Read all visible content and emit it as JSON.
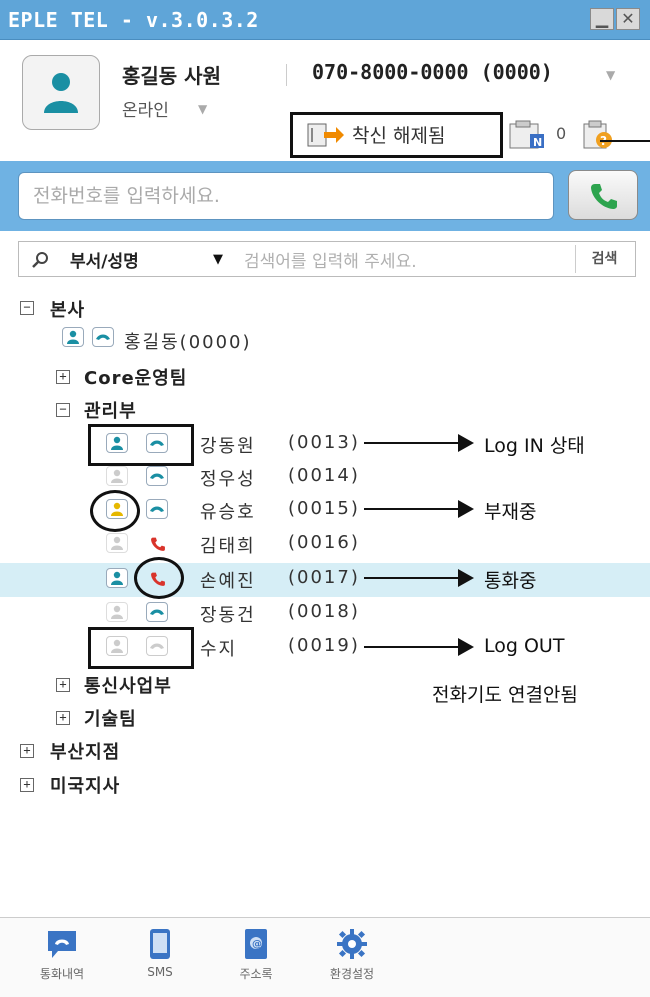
{
  "window": {
    "title": "EPLE TEL - v.3.0.3.2"
  },
  "profile": {
    "name": "홍길동 사원",
    "phone": "070-8000-0000 (0000)",
    "status": "온라인"
  },
  "forwarding": {
    "label": "착신 해제됨",
    "note_count": "0"
  },
  "dial": {
    "placeholder": "전화번호를 입력하세요."
  },
  "search": {
    "type": "부서/성명",
    "placeholder": "검색어를 입력해 주세요.",
    "button": "검색"
  },
  "tree": {
    "root": "본사",
    "head": "홍길동(0000)",
    "teams": [
      "Core운영팀",
      "관리부",
      "통신사업부",
      "기술팀"
    ],
    "members": [
      {
        "name": "강동원",
        "ext": "(0013)"
      },
      {
        "name": "정우성",
        "ext": "(0014)"
      },
      {
        "name": "유승호",
        "ext": "(0015)"
      },
      {
        "name": "김태희",
        "ext": "(0016)"
      },
      {
        "name": "손예진",
        "ext": "(0017)"
      },
      {
        "name": "장동건",
        "ext": "(0018)"
      },
      {
        "name": "수지",
        "ext": "(0019)"
      }
    ],
    "branches": [
      "부산지점",
      "미국지사"
    ]
  },
  "annotations": {
    "login": "Log IN 상태",
    "away": "부재중",
    "calling": "통화중",
    "logout": "Log OUT",
    "logout_note": "전화기도 연결안됨"
  },
  "footer": {
    "history": "통화내역",
    "sms": "SMS",
    "contacts": "주소록",
    "settings": "환경설정"
  },
  "colors": {
    "title_bar": "#5fa5d8",
    "accent_teal": "#1a8fa3",
    "call_green": "#2da44e",
    "call_red": "#d9342b",
    "away_yellow": "#e6b800"
  }
}
